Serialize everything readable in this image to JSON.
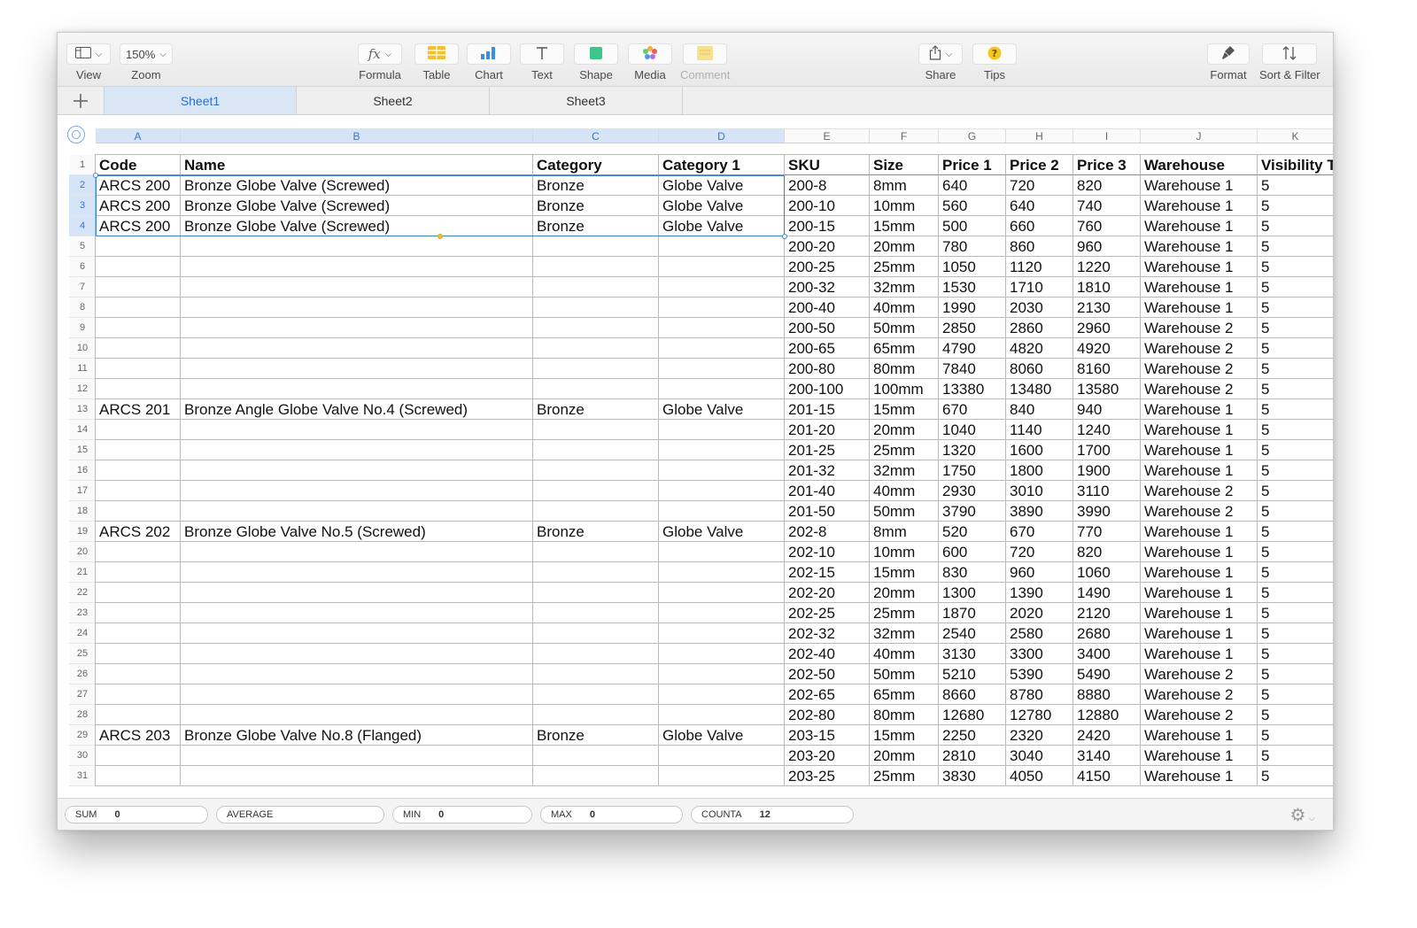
{
  "toolbar": {
    "view_label": "View",
    "zoom_value": "150%",
    "zoom_label": "Zoom",
    "formula_label": "Formula",
    "table_label": "Table",
    "chart_label": "Chart",
    "text_label": "Text",
    "shape_label": "Shape",
    "media_label": "Media",
    "comment_label": "Comment",
    "share_label": "Share",
    "tips_label": "Tips",
    "format_label": "Format",
    "sort_label": "Sort & Filter"
  },
  "sheets": [
    "Sheet1",
    "Sheet2",
    "Sheet3"
  ],
  "active_sheet": "Sheet1",
  "columns": [
    "A",
    "B",
    "C",
    "D",
    "E",
    "F",
    "G",
    "H",
    "I",
    "J",
    "K"
  ],
  "selected_columns": [
    "A",
    "B",
    "C",
    "D"
  ],
  "selected_rows": [
    2,
    3,
    4
  ],
  "header_row": [
    "Code",
    "Name",
    "Category",
    "Category 1",
    "SKU",
    "Size",
    "Price 1",
    "Price 2",
    "Price 3",
    "Warehouse",
    "Visibility T"
  ],
  "rows": [
    [
      "ARCS 200",
      "Bronze Globe Valve (Screwed)",
      "Bronze",
      "Globe Valve",
      "200-8",
      "8mm",
      "640",
      "720",
      "820",
      "Warehouse 1",
      "5"
    ],
    [
      "ARCS 200",
      "Bronze Globe Valve (Screwed)",
      "Bronze",
      "Globe Valve",
      "200-10",
      "10mm",
      "560",
      "640",
      "740",
      "Warehouse 1",
      "5"
    ],
    [
      "ARCS 200",
      "Bronze Globe Valve (Screwed)",
      "Bronze",
      "Globe Valve",
      "200-15",
      "15mm",
      "500",
      "660",
      "760",
      "Warehouse 1",
      "5"
    ],
    [
      "",
      "",
      "",
      "",
      "200-20",
      "20mm",
      "780",
      "860",
      "960",
      "Warehouse 1",
      "5"
    ],
    [
      "",
      "",
      "",
      "",
      "200-25",
      "25mm",
      "1050",
      "1120",
      "1220",
      "Warehouse 1",
      "5"
    ],
    [
      "",
      "",
      "",
      "",
      "200-32",
      "32mm",
      "1530",
      "1710",
      "1810",
      "Warehouse 1",
      "5"
    ],
    [
      "",
      "",
      "",
      "",
      "200-40",
      "40mm",
      "1990",
      "2030",
      "2130",
      "Warehouse 1",
      "5"
    ],
    [
      "",
      "",
      "",
      "",
      "200-50",
      "50mm",
      "2850",
      "2860",
      "2960",
      "Warehouse 2",
      "5"
    ],
    [
      "",
      "",
      "",
      "",
      "200-65",
      "65mm",
      "4790",
      "4820",
      "4920",
      "Warehouse 2",
      "5"
    ],
    [
      "",
      "",
      "",
      "",
      "200-80",
      "80mm",
      "7840",
      "8060",
      "8160",
      "Warehouse 2",
      "5"
    ],
    [
      "",
      "",
      "",
      "",
      "200-100",
      "100mm",
      "13380",
      "13480",
      "13580",
      "Warehouse 2",
      "5"
    ],
    [
      "ARCS 201",
      "Bronze Angle Globe Valve No.4 (Screwed)",
      "Bronze",
      "Globe Valve",
      "201-15",
      "15mm",
      "670",
      "840",
      "940",
      "Warehouse 1",
      "5"
    ],
    [
      "",
      "",
      "",
      "",
      "201-20",
      "20mm",
      "1040",
      "1140",
      "1240",
      "Warehouse 1",
      "5"
    ],
    [
      "",
      "",
      "",
      "",
      "201-25",
      "25mm",
      "1320",
      "1600",
      "1700",
      "Warehouse 1",
      "5"
    ],
    [
      "",
      "",
      "",
      "",
      "201-32",
      "32mm",
      "1750",
      "1800",
      "1900",
      "Warehouse 1",
      "5"
    ],
    [
      "",
      "",
      "",
      "",
      "201-40",
      "40mm",
      "2930",
      "3010",
      "3110",
      "Warehouse 2",
      "5"
    ],
    [
      "",
      "",
      "",
      "",
      "201-50",
      "50mm",
      "3790",
      "3890",
      "3990",
      "Warehouse 2",
      "5"
    ],
    [
      "ARCS 202",
      "Bronze Globe Valve No.5 (Screwed)",
      "Bronze",
      "Globe Valve",
      "202-8",
      "8mm",
      "520",
      "670",
      "770",
      "Warehouse 1",
      "5"
    ],
    [
      "",
      "",
      "",
      "",
      "202-10",
      "10mm",
      "600",
      "720",
      "820",
      "Warehouse 1",
      "5"
    ],
    [
      "",
      "",
      "",
      "",
      "202-15",
      "15mm",
      "830",
      "960",
      "1060",
      "Warehouse 1",
      "5"
    ],
    [
      "",
      "",
      "",
      "",
      "202-20",
      "20mm",
      "1300",
      "1390",
      "1490",
      "Warehouse 1",
      "5"
    ],
    [
      "",
      "",
      "",
      "",
      "202-25",
      "25mm",
      "1870",
      "2020",
      "2120",
      "Warehouse 1",
      "5"
    ],
    [
      "",
      "",
      "",
      "",
      "202-32",
      "32mm",
      "2540",
      "2580",
      "2680",
      "Warehouse 1",
      "5"
    ],
    [
      "",
      "",
      "",
      "",
      "202-40",
      "40mm",
      "3130",
      "3300",
      "3400",
      "Warehouse 1",
      "5"
    ],
    [
      "",
      "",
      "",
      "",
      "202-50",
      "50mm",
      "5210",
      "5390",
      "5490",
      "Warehouse 2",
      "5"
    ],
    [
      "",
      "",
      "",
      "",
      "202-65",
      "65mm",
      "8660",
      "8780",
      "8880",
      "Warehouse 2",
      "5"
    ],
    [
      "",
      "",
      "",
      "",
      "202-80",
      "80mm",
      "12680",
      "12780",
      "12880",
      "Warehouse 2",
      "5"
    ],
    [
      "ARCS 203",
      "Bronze Globe Valve No.8 (Flanged)",
      "Bronze",
      "Globe Valve",
      "203-15",
      "15mm",
      "2250",
      "2320",
      "2420",
      "Warehouse 1",
      "5"
    ],
    [
      "",
      "",
      "",
      "",
      "203-20",
      "20mm",
      "2810",
      "3040",
      "3140",
      "Warehouse 1",
      "5"
    ],
    [
      "",
      "",
      "",
      "",
      "203-25",
      "25mm",
      "3830",
      "4050",
      "4150",
      "Warehouse 1",
      "5"
    ]
  ],
  "status": {
    "sum_label": "SUM",
    "sum_value": "0",
    "average_label": "AVERAGE",
    "average_value": "",
    "min_label": "MIN",
    "min_value": "0",
    "max_label": "MAX",
    "max_value": "0",
    "counta_label": "COUNTA",
    "counta_value": "12"
  },
  "icons": {
    "view": "sidebar-layout-icon",
    "formula": "fx-icon",
    "table": "table-grid-icon",
    "chart": "bar-chart-icon",
    "text": "text-t-icon",
    "shape": "square-shape-icon",
    "media": "photos-flower-icon",
    "comment": "comment-note-icon",
    "share": "share-icon",
    "tips": "question-icon",
    "format": "paintbrush-icon",
    "sort": "sort-arrows-icon",
    "settings": "gear-icon"
  },
  "colors": {
    "accent": "#3b82d6",
    "selection_bg": "#d5e5f7",
    "table_yellow": "#f5c02b",
    "chart_blue": "#3a8ee6",
    "shape_green": "#3cc68a",
    "tips_yellow": "#f7c520"
  }
}
